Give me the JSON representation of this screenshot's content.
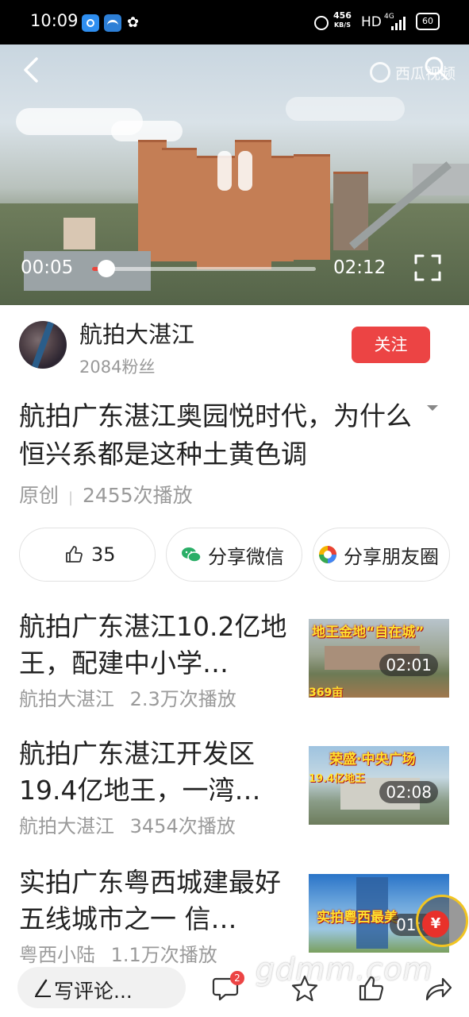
{
  "status_bar": {
    "time": "10:09",
    "net_speed_value": "456",
    "net_speed_unit": "KB/S",
    "hd": "HD",
    "network": "4G",
    "battery": "60"
  },
  "player": {
    "brand": "西瓜视频",
    "current_time": "00:05",
    "total_time": "02:12",
    "progress": 0.04
  },
  "author": {
    "name": "航拍大湛江",
    "fans": "2084粉丝",
    "follow_label": "关注"
  },
  "video": {
    "title": "航拍广东湛江奥园悦时代，为什么恒兴系都是这种土黄色调",
    "source": "原创",
    "plays": "2455次播放"
  },
  "actions": {
    "like_count": "35",
    "share_wechat": "分享微信",
    "share_moments": "分享朋友圈"
  },
  "related": [
    {
      "title": "航拍广东湛江10.2亿地王，配建中小学…",
      "author": "航拍大湛江",
      "plays": "2.3万次播放",
      "duration": "02:01",
      "banner": "地王金地“自在城”",
      "badge": "369亩"
    },
    {
      "title": "航拍广东湛江开发区19.4亿地王，一湾…",
      "author": "航拍大湛江",
      "plays": "3454次播放",
      "duration": "02:08",
      "banner": "荣盛·中央广场",
      "badge": "19.4亿地王"
    },
    {
      "title": "实拍广东粤西城建最好五线城市之一 信…",
      "author": "粤西小陆",
      "plays": "1.1万次播放",
      "duration": "01:5",
      "banner": "实拍粤西最美",
      "badge": ""
    }
  ],
  "bottom_bar": {
    "comment_placeholder": "写评论...",
    "comment_count": "2",
    "coin_symbol": "¥",
    "watermark": "gdmm.com"
  },
  "colors": {
    "accent": "#ec4444",
    "meta_gray": "#9a9a9a",
    "pill_border": "#e2e2e2",
    "wechat_green": "#2aae67"
  }
}
